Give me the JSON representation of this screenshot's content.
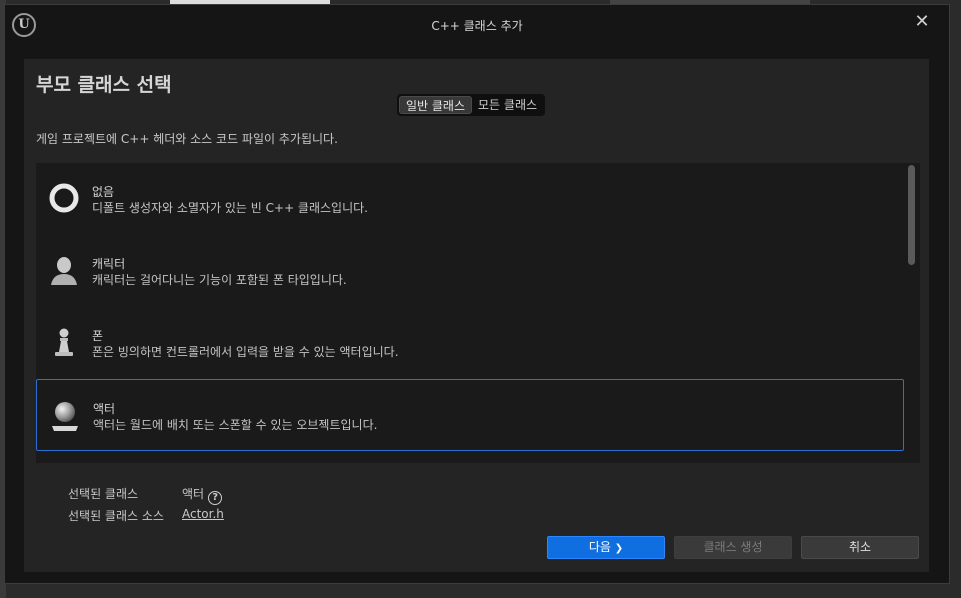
{
  "window": {
    "title": "C++ 클래스 추가",
    "close_icon": "close-icon",
    "logo_text": "U"
  },
  "panel": {
    "heading": "부모 클래스 선택",
    "tabs": [
      {
        "label": "일반 클래스",
        "active": true
      },
      {
        "label": "모든 클래스",
        "active": false
      }
    ],
    "description": "게임 프로젝트에 C++ 헤더와 소스 코드 파일이 추가됩니다."
  },
  "classes": [
    {
      "name": "없음",
      "description": "디폴트 생성자와 소멸자가 있는 빈 C++ 클래스입니다.",
      "icon": "ring-icon",
      "selected": false
    },
    {
      "name": "캐릭터",
      "description": "캐릭터는 걸어다니는 기능이 포함된 폰 타입입니다.",
      "icon": "character-icon",
      "selected": false
    },
    {
      "name": "폰",
      "description": "폰은 빙의하면 컨트롤러에서 입력을 받을 수 있는 액터입니다.",
      "icon": "pawn-icon",
      "selected": false
    },
    {
      "name": "액터",
      "description": "액터는 월드에 배치 또는 스폰할 수 있는 오브젝트입니다.",
      "icon": "actor-sphere-icon",
      "selected": true
    }
  ],
  "selection": {
    "class_label": "선택된 클래스",
    "class_value": "액터",
    "help_icon": "help-icon",
    "help_text": "?",
    "source_label": "선택된 클래스 소스",
    "source_value": "Actor.h"
  },
  "buttons": {
    "next": "다음",
    "next_chevron": "❯",
    "create": "클래스 생성",
    "cancel": "취소"
  },
  "colors": {
    "accent": "#0f6fe0",
    "selection_border": "#2f6fd0",
    "panel_bg": "#242424",
    "window_bg": "#151515"
  }
}
